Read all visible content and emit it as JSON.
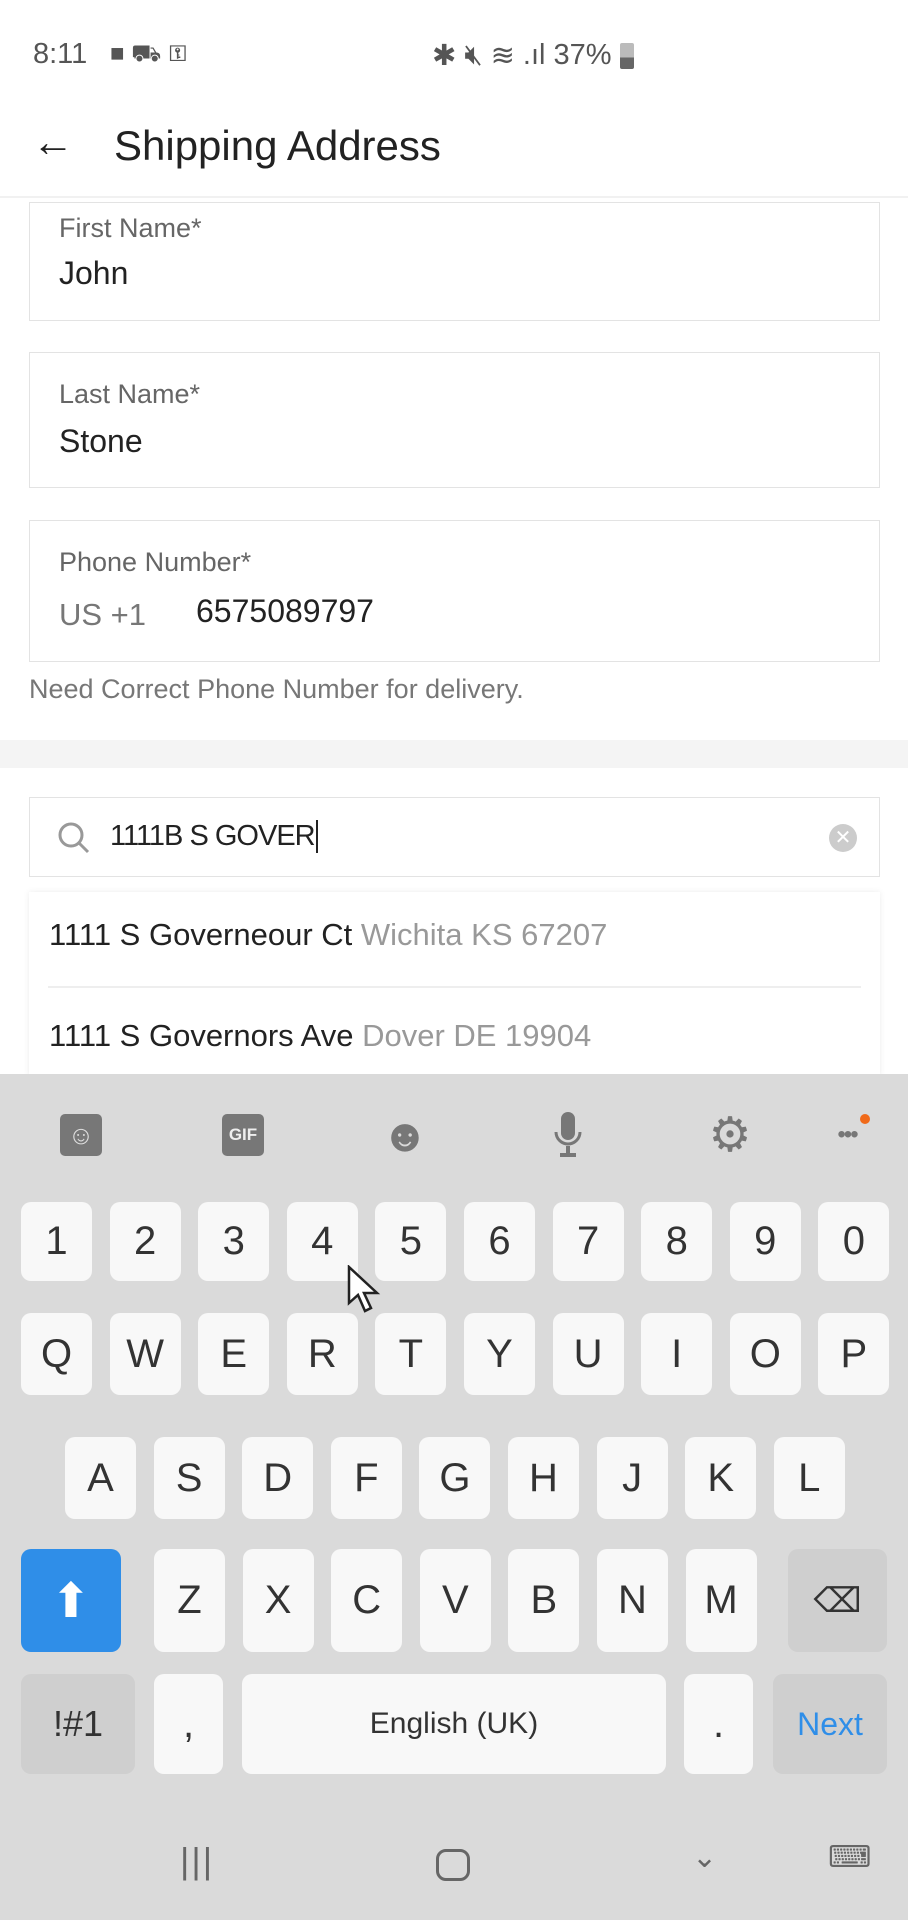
{
  "status_bar": {
    "time": "8:11",
    "battery": "37%",
    "icons": [
      "video-camera-icon",
      "car-icon",
      "key-icon",
      "bluetooth-icon",
      "mute-icon",
      "wifi-icon",
      "signal-icon",
      "battery-icon"
    ]
  },
  "header": {
    "title": "Shipping Address",
    "back_icon": "arrow-left-icon"
  },
  "form": {
    "first_name": {
      "label": "First Name*",
      "value": "John"
    },
    "last_name": {
      "label": "Last Name*",
      "value": "Stone"
    },
    "phone": {
      "label": "Phone Number*",
      "country_code": "US +1",
      "value": "6575089797"
    },
    "helper": "Need Correct Phone Number for delivery."
  },
  "search": {
    "value": "1111B S GOVER"
  },
  "suggestions": [
    {
      "street": "1111 S Governeour Ct",
      "city": "Wichita KS 67207"
    },
    {
      "street": "1111 S Governors Ave",
      "city": "Dover DE 19904"
    }
  ],
  "keyboard": {
    "toolbar": [
      "sticker-icon",
      "GIF",
      "emoji-icon",
      "microphone-icon",
      "settings-icon",
      "more-icon"
    ],
    "row_numbers": [
      "1",
      "2",
      "3",
      "4",
      "5",
      "6",
      "7",
      "8",
      "9",
      "0"
    ],
    "row1": [
      "Q",
      "W",
      "E",
      "R",
      "T",
      "Y",
      "U",
      "I",
      "O",
      "P"
    ],
    "row2": [
      "A",
      "S",
      "D",
      "F",
      "G",
      "H",
      "J",
      "K",
      "L"
    ],
    "row3": [
      "Z",
      "X",
      "C",
      "V",
      "B",
      "N",
      "M"
    ],
    "symbols": "!#1",
    "comma": ",",
    "space": "English (UK)",
    "period": ".",
    "next": "Next",
    "accent": "#2f8ee8"
  }
}
